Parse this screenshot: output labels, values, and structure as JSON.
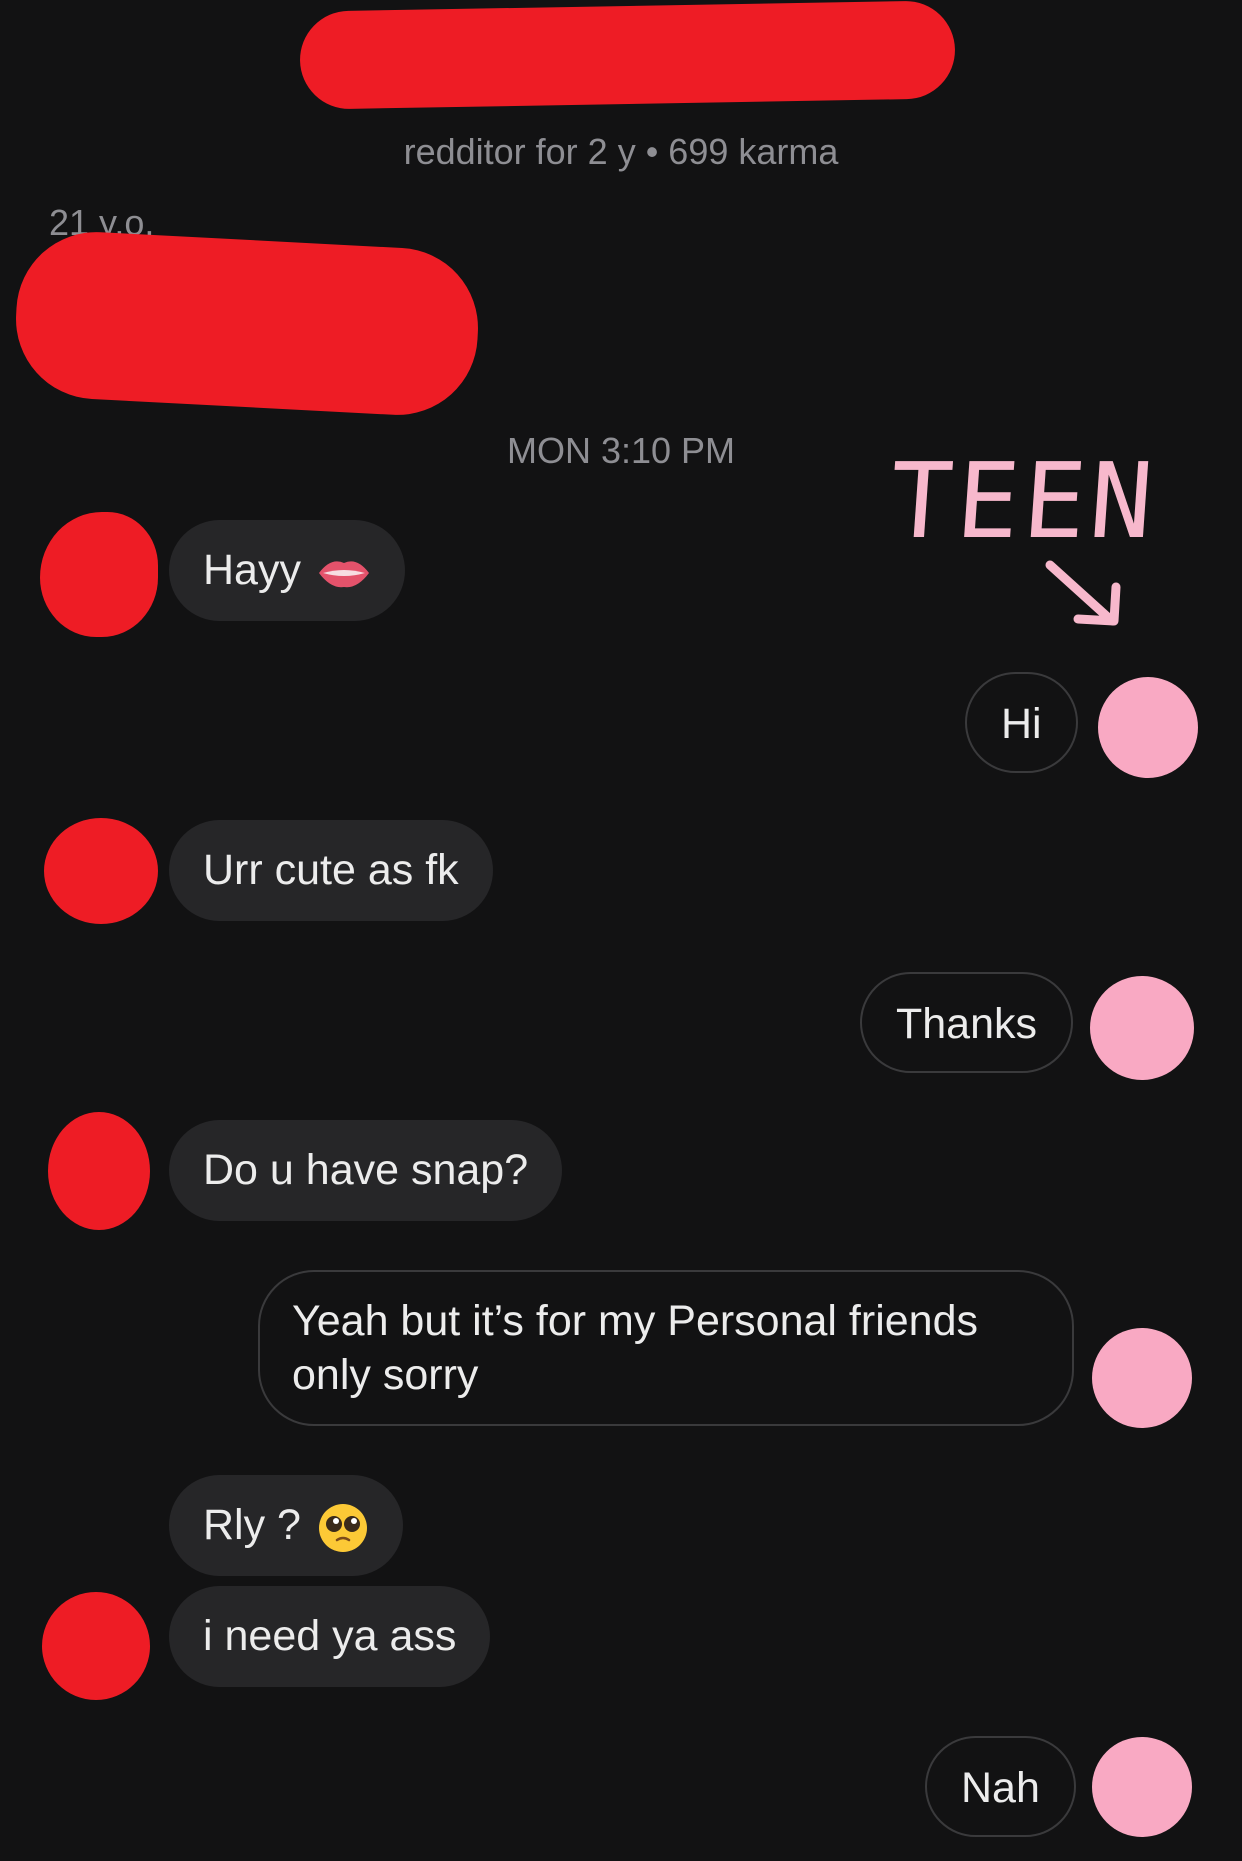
{
  "header": {
    "meta": "redditor for 2 y • 699 karma",
    "age": "21 y.o."
  },
  "timestamp": "MON 3:10 PM",
  "annotation": {
    "text": "TEEN",
    "arrow_icon": "arrow-down-right-icon",
    "color": "#f7b8cc"
  },
  "messages": [
    {
      "from": "them",
      "text": "Hayy",
      "emoji": "lips-emoji"
    },
    {
      "from": "me",
      "text": "Hi"
    },
    {
      "from": "them",
      "text": "Urr cute as fk"
    },
    {
      "from": "me",
      "text": "Thanks"
    },
    {
      "from": "them",
      "text": "Do u have snap?"
    },
    {
      "from": "me",
      "line1": "Yeah but it’s for my Personal friends",
      "line2": "only sorry"
    },
    {
      "from": "them",
      "text": "Rly ?",
      "emoji": "pleading-face-emoji"
    },
    {
      "from": "them",
      "text": "i need ya ass"
    },
    {
      "from": "me",
      "text": "Nah"
    }
  ],
  "colors": {
    "background": "#121213",
    "incoming_bubble": "#262628",
    "outgoing_border": "#3a3a3c",
    "redaction": "#ee1c25",
    "my_avatar": "#f9a9c3"
  }
}
